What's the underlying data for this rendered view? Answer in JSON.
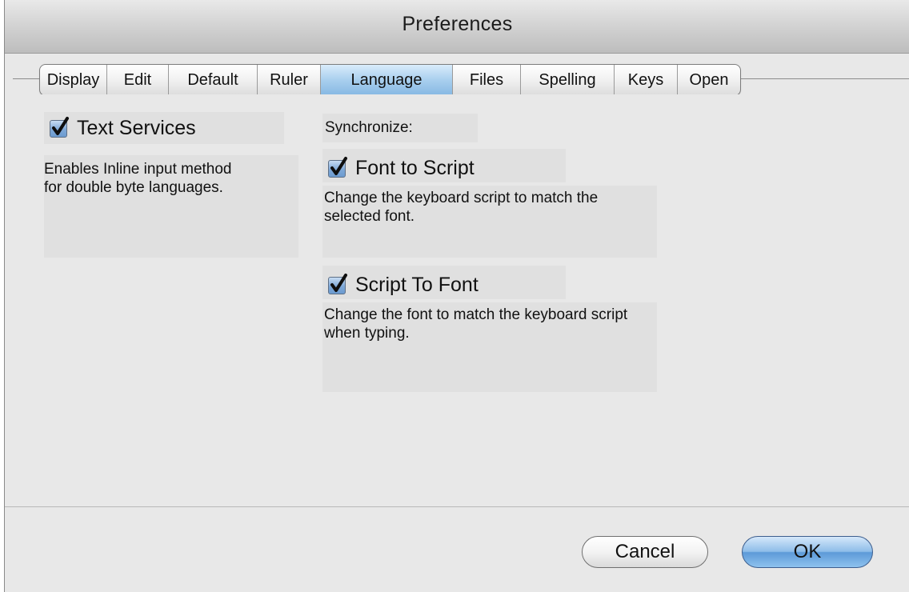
{
  "window": {
    "title": "Preferences"
  },
  "tabs": [
    {
      "label": "Display",
      "selected": false
    },
    {
      "label": "Edit",
      "selected": false
    },
    {
      "label": "Default",
      "selected": false
    },
    {
      "label": "Ruler",
      "selected": false
    },
    {
      "label": "Language",
      "selected": true
    },
    {
      "label": "Files",
      "selected": false
    },
    {
      "label": "Spelling",
      "selected": false
    },
    {
      "label": "Keys",
      "selected": false
    },
    {
      "label": "Open",
      "selected": false
    }
  ],
  "text_services": {
    "label": "Text Services",
    "checked": true,
    "description": "Enables Inline input method for double byte languages."
  },
  "synchronize": {
    "label": "Synchronize:",
    "font_to_script": {
      "label": "Font to Script",
      "checked": true,
      "description": "Change the keyboard script to match the selected font."
    },
    "script_to_font": {
      "label": "Script To Font",
      "checked": true,
      "description": "Change the font to match the keyboard script when typing."
    }
  },
  "buttons": {
    "cancel": "Cancel",
    "ok": "OK"
  },
  "colors": {
    "accent": "#86b8e3",
    "window_bg": "#e8e8e8"
  }
}
